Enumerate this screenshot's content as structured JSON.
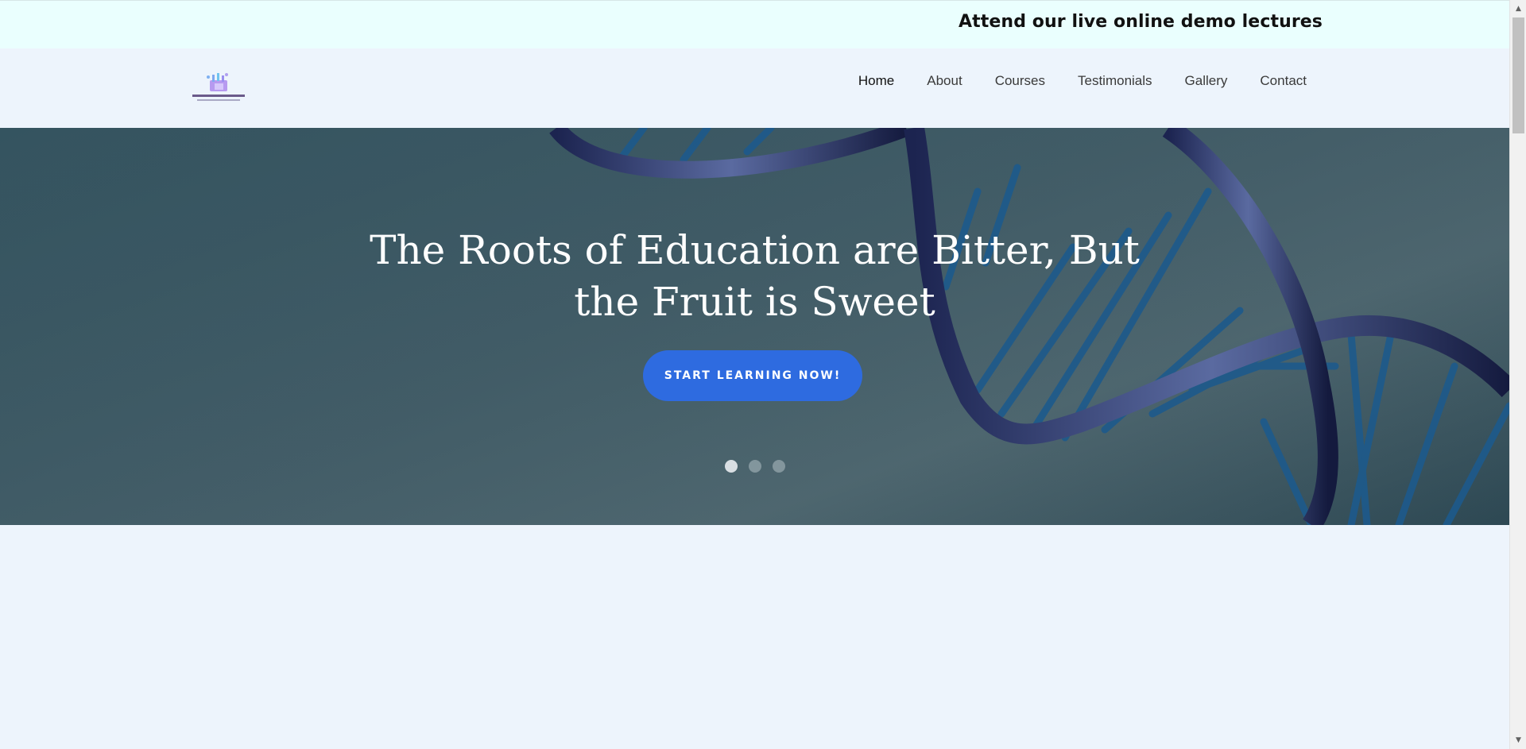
{
  "announcement": {
    "text": "Attend our live online demo lectures"
  },
  "header": {
    "logo_icon": "digital-sirs-chemistry-logo",
    "nav": [
      {
        "label": "Home",
        "active": true
      },
      {
        "label": "About"
      },
      {
        "label": "Courses"
      },
      {
        "label": "Testimonials"
      },
      {
        "label": "Gallery"
      },
      {
        "label": "Contact"
      }
    ]
  },
  "hero": {
    "title_line1": "The Roots of Education are Bitter, But",
    "title_line2": "the Fruit is Sweet",
    "cta_label": "START LEARNING NOW!",
    "slide_count": 3,
    "active_slide": 1,
    "background_icon": "dna-helix-image"
  },
  "colors": {
    "announce_bg": "#eafffe",
    "page_bg": "#edf4fc",
    "cta_bg": "#2e6be0",
    "hero_bg": "#4c6670"
  }
}
